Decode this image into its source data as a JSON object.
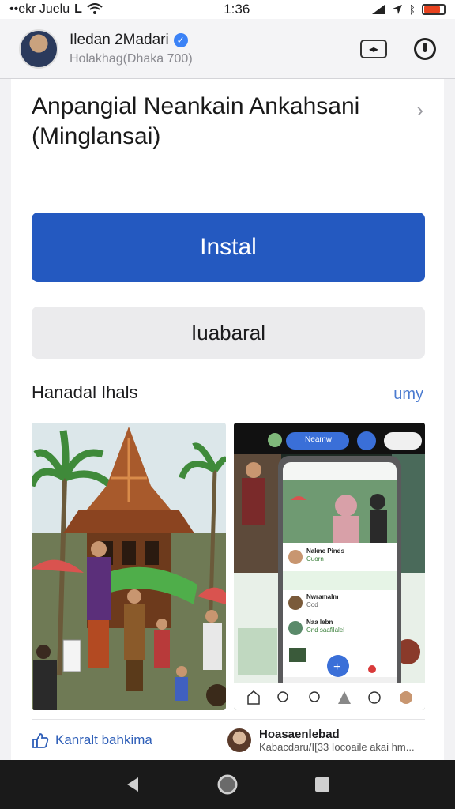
{
  "status_bar": {
    "carrier": "••ekr Juelu",
    "time": "1:36",
    "battery_level": 0.85,
    "battery_color": "#e8431f"
  },
  "header": {
    "name": "Iledan 2Madari",
    "subtitle": "Holakhag(Dhaka 700)",
    "verified_icon": "verified-badge-icon",
    "accent": "#3b82f6"
  },
  "app": {
    "title": "Anpangial Neankain Ankahsani (Minglansai)",
    "install_label": "Instal",
    "secondary_label": "Iuabaral",
    "install_color": "#2459c0"
  },
  "screenshots": {
    "heading": "Hanadal Ihals",
    "more_label": "umy",
    "chat_pill": "Neamw",
    "list": [
      {
        "name": "Nakne Pinds",
        "desc": "Cuorn"
      },
      {
        "name": "Nwramalm",
        "desc": "Cod"
      },
      {
        "name": "Naa lebn",
        "desc": "Cnd saafilalel"
      }
    ]
  },
  "footer": {
    "like_label": "Kanralt bahkima",
    "user_name": "Hoasaenlebad",
    "user_desc": "Kabacdaru/I[33 Iocoaile akai hm..."
  },
  "navbar": {
    "back_icon": "back-triangle-icon",
    "home_icon": "home-circle-icon",
    "recents_icon": "recents-square-icon"
  }
}
